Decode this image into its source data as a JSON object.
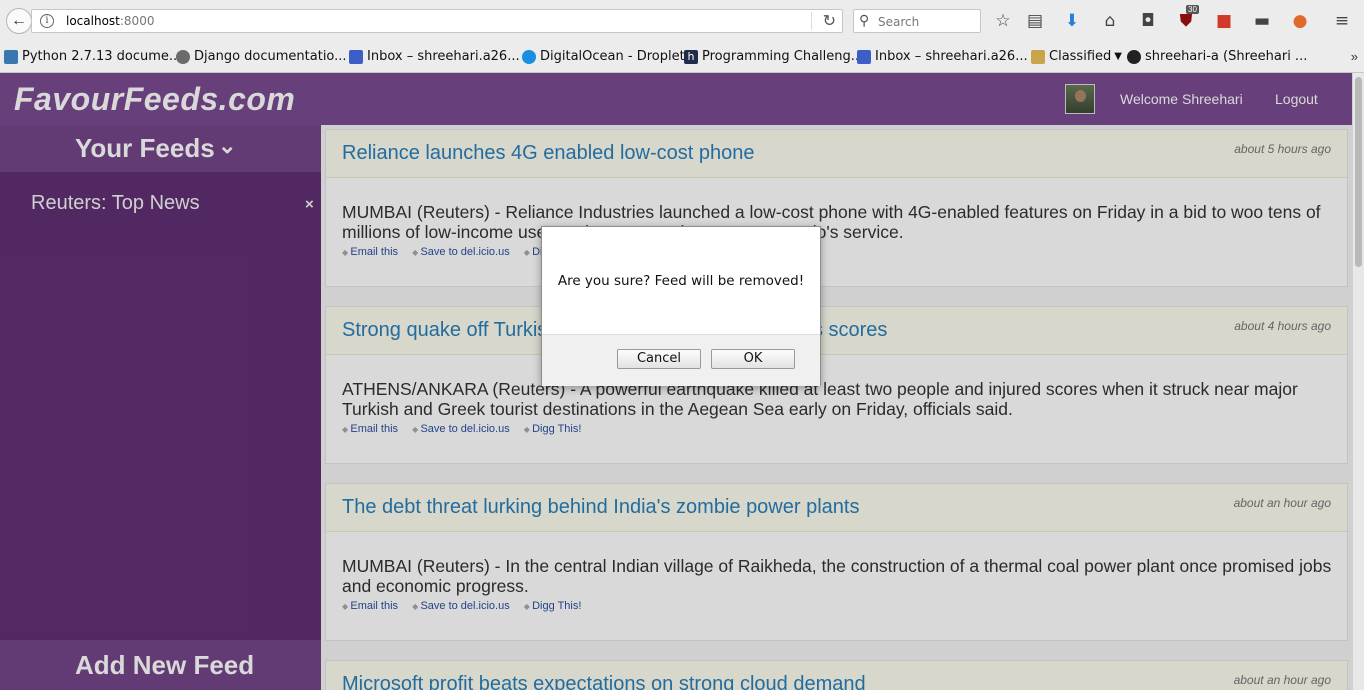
{
  "browser": {
    "url_host": "localhost",
    "url_port": ":8000",
    "search_placeholder": "Search",
    "ext_badge": "30",
    "bookmarks": [
      {
        "label": "Python 2.7.13 docume...",
        "icon_color": "#3a76b0"
      },
      {
        "label": "Django documentatio...",
        "icon_color": "#6b6b6b"
      },
      {
        "label": "Inbox – shreehari.a26...",
        "icon_color": "#3b5fc4"
      },
      {
        "label": "DigitalOcean - Droplets",
        "icon_color": "#1a8ee0"
      },
      {
        "label": "Programming Challeng...",
        "icon_color": "#1f2d4a"
      },
      {
        "label": "Inbox – shreehari.a26...",
        "icon_color": "#3b5fc4"
      },
      {
        "label": "Classified",
        "icon_color": "#c9a44a"
      },
      {
        "label": "shreehari-a (Shreehari ...",
        "icon_color": "#222222"
      }
    ],
    "bookmarks_more": "»"
  },
  "header": {
    "brand": "FavourFeeds.com",
    "welcome": "Welcome Shreehari",
    "logout": "Logout"
  },
  "sidebar": {
    "title": "Your Feeds",
    "feeds": [
      {
        "label": "Reuters: Top News",
        "remove": "×"
      }
    ],
    "add_feed": "Add New Feed"
  },
  "articles": [
    {
      "title": "Reliance launches 4G enabled low-cost phone",
      "time": "about 5 hours ago",
      "body": "MUMBAI (Reuters) - Reliance Industries launched a low-cost phone with 4G-enabled features on Friday in a bid to woo tens of millions of low-income users to its upstart telecoms venture Jio's service.",
      "links": [
        "Email this",
        "Save to del.icio.us",
        "Digg This!"
      ]
    },
    {
      "title": "Strong quake off Turkish, Greek coast kills two, injures scores",
      "time": "about 4 hours ago",
      "body": "ATHENS/ANKARA (Reuters) - A powerful earthquake killed at least two people and injured scores when it struck near major Turkish and Greek tourist destinations in the Aegean Sea early on Friday, officials said.",
      "links": [
        "Email this",
        "Save to del.icio.us",
        "Digg This!"
      ]
    },
    {
      "title": "The debt threat lurking behind India's zombie power plants",
      "time": "about an hour ago",
      "body": "MUMBAI (Reuters) - In the central Indian village of Raikheda, the construction of a thermal coal power plant once promised jobs and economic progress.",
      "links": [
        "Email this",
        "Save to del.icio.us",
        "Digg This!"
      ]
    },
    {
      "title": "Microsoft profit beats expectations on strong cloud demand",
      "time": "about an hour ago",
      "body": "",
      "links": []
    }
  ],
  "dialog": {
    "message": "Are you sure? Feed will be removed!",
    "cancel": "Cancel",
    "ok": "OK"
  }
}
